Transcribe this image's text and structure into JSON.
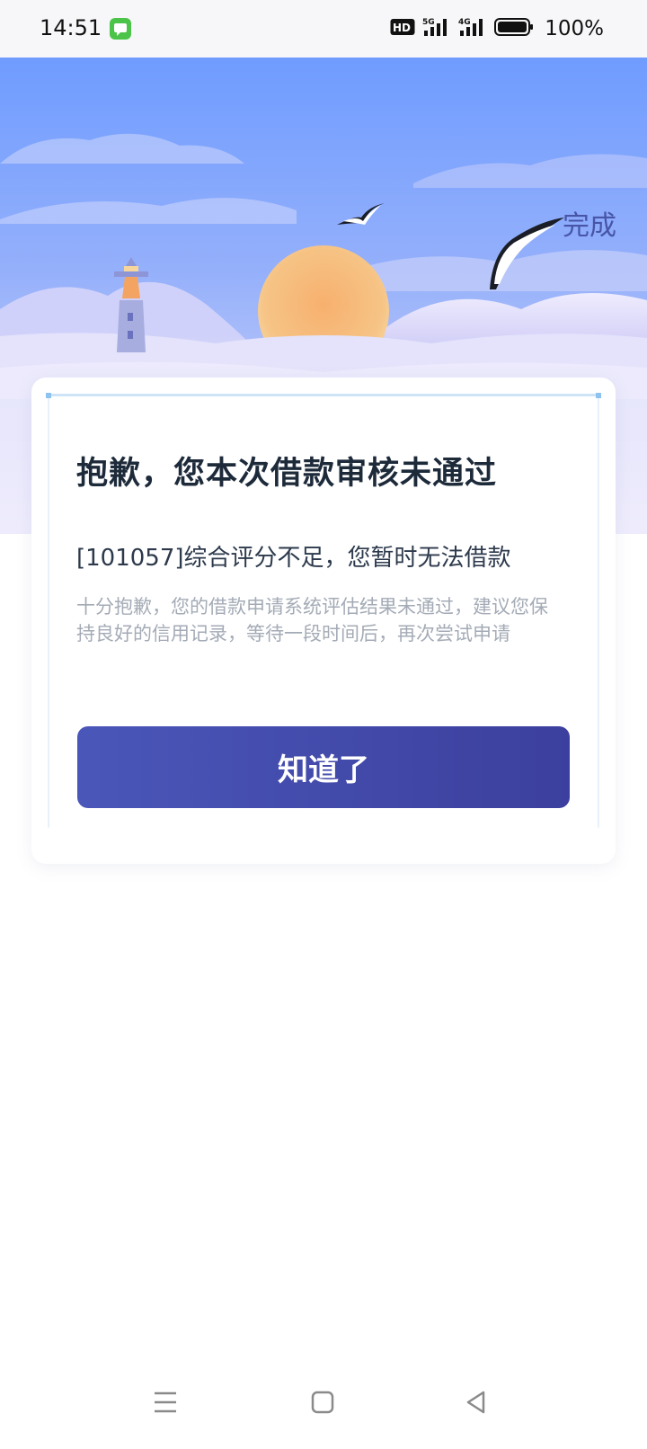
{
  "status_bar": {
    "time": "14:51",
    "battery_percent": "100%",
    "icons": [
      "message-app-icon",
      "hd-icon",
      "5g-signal-icon",
      "4g-signal-icon",
      "battery-icon"
    ]
  },
  "header": {
    "done_label": "完成"
  },
  "dialog": {
    "title": "抱歉，您本次借款审核未通过",
    "reason": "[101057]综合评分不足，您暂时无法借款",
    "description": "十分抱歉，您的借款申请系统评估结果未通过，建议您保持良好的信用记录，等待一段时间后，再次尝试申请",
    "ok_label": "知道了"
  },
  "nav_bar": {
    "icons": [
      "menu-icon",
      "home-icon",
      "back-icon"
    ]
  },
  "colors": {
    "accent": "#4a57b9",
    "done_text": "#4855a7",
    "title_text": "#1d2a3a",
    "description_text": "#a4abb6"
  }
}
